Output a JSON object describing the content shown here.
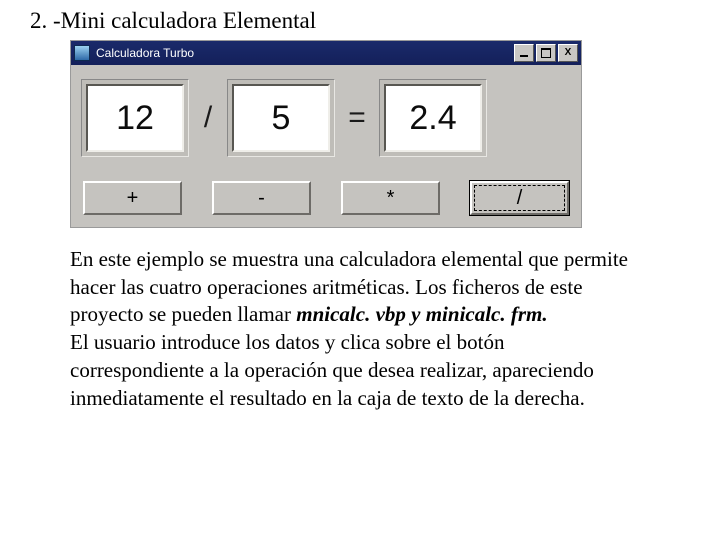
{
  "heading": "2. -Mini calculadora Elemental",
  "window": {
    "title": "Calculadora Turbo",
    "close_glyph": "X"
  },
  "calc": {
    "op1": "12",
    "op2": "5",
    "result": "2.4",
    "operator_symbol": "/",
    "equals_symbol": "=",
    "buttons": {
      "add": "+",
      "sub": "-",
      "mul": "*",
      "div": "/"
    }
  },
  "para1_a": "En este ejemplo se muestra una calculadora elemental que permite hacer las cuatro operaciones aritméticas. Los ficheros de este proyecto se pueden llamar ",
  "files": "mnicalc. vbp y minicalc. frm.",
  "para2": "El usuario introduce los datos y clica sobre el botón correspondiente a la operación que desea realizar, apareciendo inmediatamente el resultado en la caja de texto de la derecha."
}
